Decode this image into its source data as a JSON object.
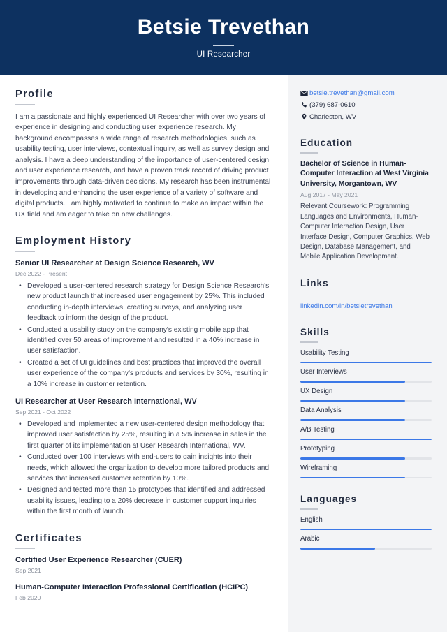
{
  "header": {
    "name": "Betsie Trevethan",
    "job_title": "UI Researcher"
  },
  "main": {
    "profile": {
      "heading": "Profile",
      "text": "I am a passionate and highly experienced UI Researcher with over two years of experience in designing and conducting user experience research. My background encompasses a wide range of research methodologies, such as usability testing, user interviews, contextual inquiry, as well as survey design and analysis. I have a deep understanding of the importance of user-centered design and user experience research, and have a proven track record of driving product improvements through data-driven decisions. My research has been instrumental in developing and enhancing the user experience of a variety of software and digital products. I am highly motivated to continue to make an impact within the UX field and am eager to take on new challenges."
    },
    "employment": {
      "heading": "Employment History",
      "jobs": [
        {
          "title": "Senior UI Researcher at Design Science Research, WV",
          "date": "Dec 2022 - Present",
          "bullets": [
            "Developed a user-centered research strategy for Design Science Research's new product launch that increased user engagement by 25%. This included conducting in-depth interviews, creating surveys, and analyzing user feedback to inform the design of the product.",
            "Conducted a usability study on the company's existing mobile app that identified over 50 areas of improvement and resulted in a 40% increase in user satisfaction.",
            "Created a set of UI guidelines and best practices that improved the overall user experience of the company's products and services by 30%, resulting in a 10% increase in customer retention."
          ]
        },
        {
          "title": "UI Researcher at User Research International, WV",
          "date": "Sep 2021 - Oct 2022",
          "bullets": [
            "Developed and implemented a new user-centered design methodology that improved user satisfaction by 25%, resulting in a 5% increase in sales in the first quarter of its implementation at User Research International, WV.",
            "Conducted over 100 interviews with end-users to gain insights into their needs, which allowed the organization to develop more tailored products and services that increased customer retention by 10%.",
            "Designed and tested more than 15 prototypes that identified and addressed usability issues, leading to a 20% decrease in customer support inquiries within the first month of launch."
          ]
        }
      ]
    },
    "certificates": {
      "heading": "Certificates",
      "items": [
        {
          "name": "Certified User Experience Researcher (CUER)",
          "date": "Sep 2021"
        },
        {
          "name": "Human-Computer Interaction Professional Certification (HCIPC)",
          "date": "Feb 2020"
        }
      ]
    }
  },
  "sidebar": {
    "contact": [
      {
        "icon": "envelope-icon",
        "text": "betsie.trevethan@gmail.com",
        "is_link": true
      },
      {
        "icon": "phone-icon",
        "text": "(379) 687-0610",
        "is_link": false
      },
      {
        "icon": "map-pin-icon",
        "text": "Charleston, WV",
        "is_link": false
      }
    ],
    "education": {
      "heading": "Education",
      "degree": "Bachelor of Science in Human-Computer Interaction at West Virginia University, Morgantown, WV",
      "date": "Aug 2017 - May 2021",
      "description": "Relevant Coursework: Programming Languages and Environments, Human-Computer Interaction Design, User Interface Design, Computer Graphics, Web Design, Database Management, and Mobile Application Development."
    },
    "links": {
      "heading": "Links",
      "items": [
        {
          "label": "linkedin.com/in/betsietrevethan"
        }
      ]
    },
    "skills": {
      "heading": "Skills",
      "items": [
        {
          "label": "Usability Testing",
          "level": 100
        },
        {
          "label": "User Interviews",
          "level": 80
        },
        {
          "label": "UX Design",
          "level": 80
        },
        {
          "label": "Data Analysis",
          "level": 80
        },
        {
          "label": "A/B Testing",
          "level": 100
        },
        {
          "label": "Prototyping",
          "level": 80
        },
        {
          "label": "Wireframing",
          "level": 80
        }
      ]
    },
    "languages": {
      "heading": "Languages",
      "items": [
        {
          "label": "English",
          "level": 100
        },
        {
          "label": "Arabic",
          "level": 57
        }
      ]
    }
  },
  "colors": {
    "header_bg": "#0d3160",
    "sidebar_bg": "#f3f4f6",
    "accent": "#3b78e7",
    "text": "#2b3245",
    "muted": "#8b919d"
  }
}
